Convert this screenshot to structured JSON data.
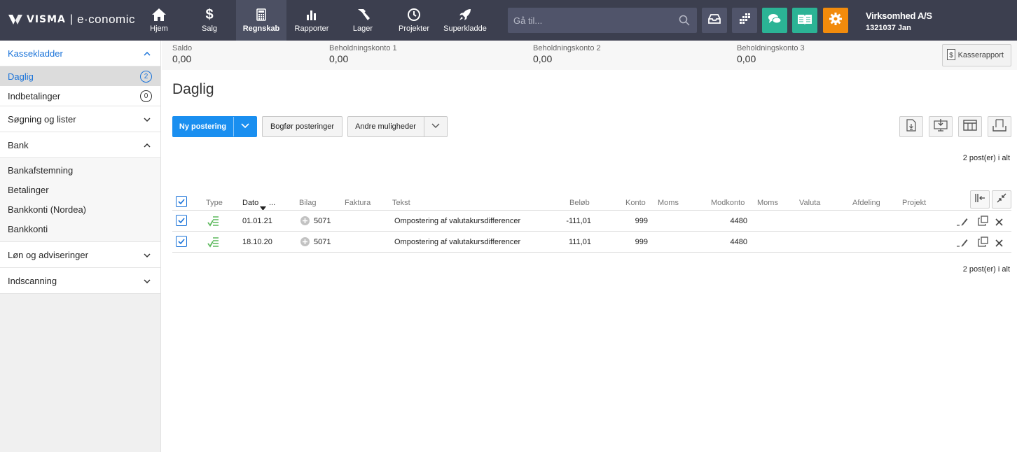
{
  "nav": {
    "brand": "VISMA",
    "product": "e·conomic",
    "items": [
      {
        "label": "Hjem",
        "icon": "home-icon"
      },
      {
        "label": "Salg",
        "icon": "dollar-icon"
      },
      {
        "label": "Regnskab",
        "icon": "calculator-icon",
        "active": true
      },
      {
        "label": "Rapporter",
        "icon": "bar-chart-icon"
      },
      {
        "label": "Lager",
        "icon": "hammer-icon"
      },
      {
        "label": "Projekter",
        "icon": "clock-icon"
      },
      {
        "label": "Superkladde",
        "icon": "rocket-icon"
      }
    ],
    "search_placeholder": "Gå til...",
    "company_name": "Virksomhed A/S",
    "user": "1321037 Jan",
    "colors": {
      "chat": "#2bb395",
      "book": "#2bb395",
      "settings": "#f28b0c",
      "bar": "#3c3f4f"
    }
  },
  "sidebar": {
    "kassekladder": "Kassekladder",
    "daglig": "Daglig",
    "daglig_count": "2",
    "indbetalinger": "Indbetalinger",
    "indbetalinger_count": "0",
    "soegning": "Søgning og lister",
    "bank": "Bank",
    "bank_items": [
      "Bankafstemning",
      "Betalinger",
      "Bankkonti (Nordea)",
      "Bankkonti"
    ],
    "loen": "Løn og adviseringer",
    "indscanning": "Indscanning"
  },
  "summary": {
    "saldo_label": "Saldo",
    "saldo_value": "0,00",
    "bk1_label": "Beholdningskonto 1",
    "bk1_value": "0,00",
    "bk2_label": "Beholdningskonto 2",
    "bk2_value": "0,00",
    "bk3_label": "Beholdningskonto 3",
    "bk3_value": "0,00",
    "kasserapport": "Kasserapport"
  },
  "page_title": "Daglig",
  "toolbar": {
    "new_entry": "Ny postering",
    "post_entries": "Bogfør posteringer",
    "other_options": "Andre muligheder"
  },
  "count_label": "2 post(er) i alt",
  "table": {
    "headers": {
      "type": "Type",
      "dato": "Dato",
      "dato_more": "...",
      "bilag": "Bilag",
      "faktura": "Faktura",
      "tekst": "Tekst",
      "beloeb": "Beløb",
      "konto": "Konto",
      "moms": "Moms",
      "modkonto": "Modkonto",
      "moms2": "Moms",
      "valuta": "Valuta",
      "afdeling": "Afdeling",
      "projekt": "Projekt"
    },
    "rows": [
      {
        "dato": "01.01.21",
        "bilag": "5071",
        "tekst": "Ompostering af valutakursdifferencer",
        "beloeb": "-111,01",
        "konto": "999",
        "modkonto": "4480"
      },
      {
        "dato": "18.10.20",
        "bilag": "5071",
        "tekst": "Ompostering af valutakursdifferencer",
        "beloeb": "111,01",
        "konto": "999",
        "modkonto": "4480"
      }
    ]
  }
}
